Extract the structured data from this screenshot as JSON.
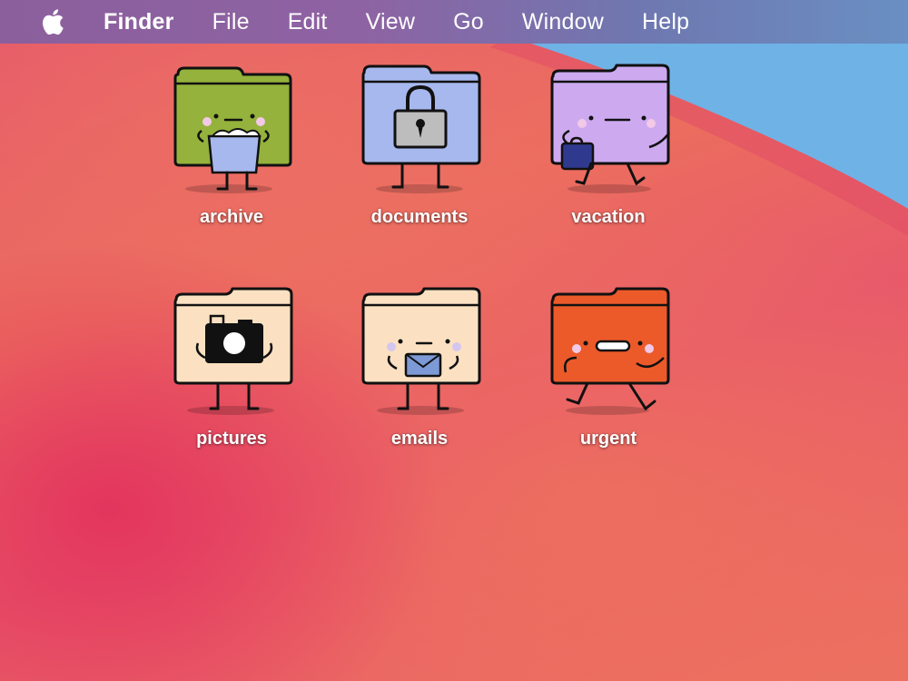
{
  "menubar": {
    "apple_icon": "apple-logo-icon",
    "app_name": "Finder",
    "items": [
      "File",
      "Edit",
      "View",
      "Go",
      "Window",
      "Help"
    ]
  },
  "desktop": {
    "folders": [
      {
        "label": "archive",
        "color": "#94b23c",
        "character": "holding-box"
      },
      {
        "label": "documents",
        "color": "#a7b8ee",
        "character": "padlock"
      },
      {
        "label": "vacation",
        "color": "#cdaaf0",
        "character": "walking-with-suitcase"
      },
      {
        "label": "pictures",
        "color": "#fbe1c2",
        "character": "camera"
      },
      {
        "label": "emails",
        "color": "#fbe1c2",
        "character": "holding-envelope"
      },
      {
        "label": "urgent",
        "color": "#ec5a2a",
        "character": "running"
      }
    ]
  },
  "colors": {
    "menubar_left": "#8b5f9c",
    "menubar_right": "#6a8fc2",
    "wallpaper_coral": "#ec6e5e",
    "wallpaper_blue": "#6fb2e6"
  }
}
